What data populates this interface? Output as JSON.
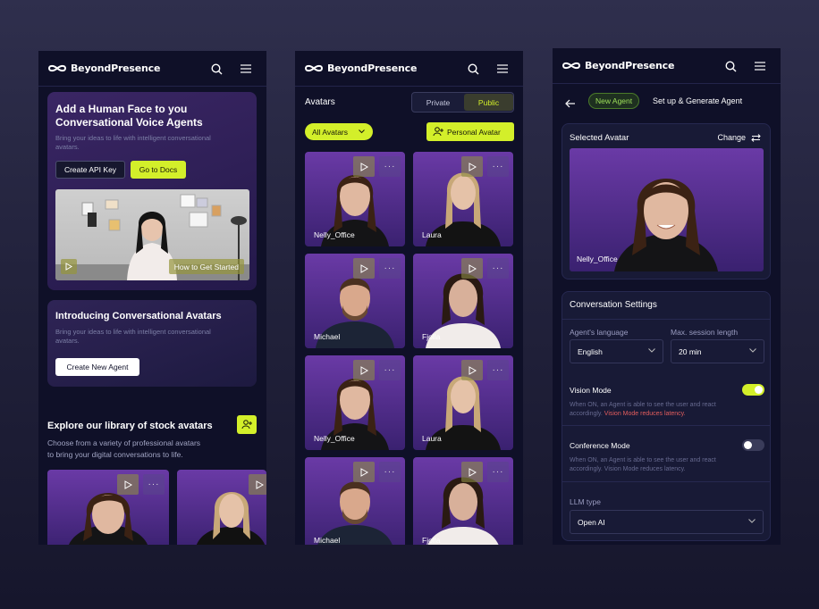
{
  "brand": {
    "name": "BeyondPresence",
    "accent": "#d3ef2a",
    "background": "#0f1028"
  },
  "icons": {
    "search": "search-icon",
    "menu": "hamburger-menu-icon",
    "play": "play-icon",
    "more": "more-dots-icon",
    "back": "arrow-left-icon",
    "swap": "swap-icon",
    "add_user": "add-user-icon",
    "chevron": "chevron-down-icon"
  },
  "home": {
    "hero_title_line1": "Add a Human Face to you",
    "hero_title_line2": "Conversational Voice Agents",
    "hero_sub_line1": "Bring your ideas to life with intelligent conversational",
    "hero_sub_line2": "avatars.",
    "api_button": "Create API Key",
    "docs_button": "Go to Docs",
    "video_label": "How to Get Started",
    "intro_title": "Introducing Conversational Avatars",
    "intro_sub_line1": "Bring your ideas to life with intelligent conversational",
    "intro_sub_line2": "avatars.",
    "create_button": "Create New Agent",
    "explore_title": "Explore our library of stock avatars",
    "explore_sub_line1": "Choose from a variety of professional avatars",
    "explore_sub_line2": "to bring your digital conversations to life."
  },
  "avatars": {
    "title": "Avatars",
    "tab_private": "Private",
    "tab_public": "Public",
    "filter": "All Avatars",
    "personal_button": "Personal Avatar",
    "tiles": [
      {
        "name": "Nelly_Office"
      },
      {
        "name": "Laura"
      },
      {
        "name": "Michael"
      },
      {
        "name": "Fjolla"
      },
      {
        "name": "Nelly_Office"
      },
      {
        "name": "Laura"
      },
      {
        "name": "Michael"
      },
      {
        "name": "Fjolla"
      }
    ]
  },
  "agent": {
    "badge": "New Agent",
    "title": "Set up & Generate Agent",
    "selected_label": "Selected Avatar",
    "change_label": "Change",
    "avatar_name": "Nelly_Office",
    "settings_title": "Conversation Settings",
    "language_label": "Agent's language",
    "language_value": "English",
    "session_label": "Max. session length",
    "session_value": "20 min",
    "vision_label": "Vision Mode",
    "vision_on": true,
    "vision_desc_line1": "When ON, an Agent is able to see the user and react",
    "vision_desc_line2a": "accordingly. ",
    "vision_desc_line2b": "Vision Mode reduces latency.",
    "conference_label": "Conference Mode",
    "conference_on": false,
    "conference_desc_line1": "When ON, an Agent is able to see the user and react",
    "conference_desc_line2": "accordingly. Vision Mode reduces latency.",
    "llm_label": "LLM type",
    "llm_value": "Open AI"
  }
}
